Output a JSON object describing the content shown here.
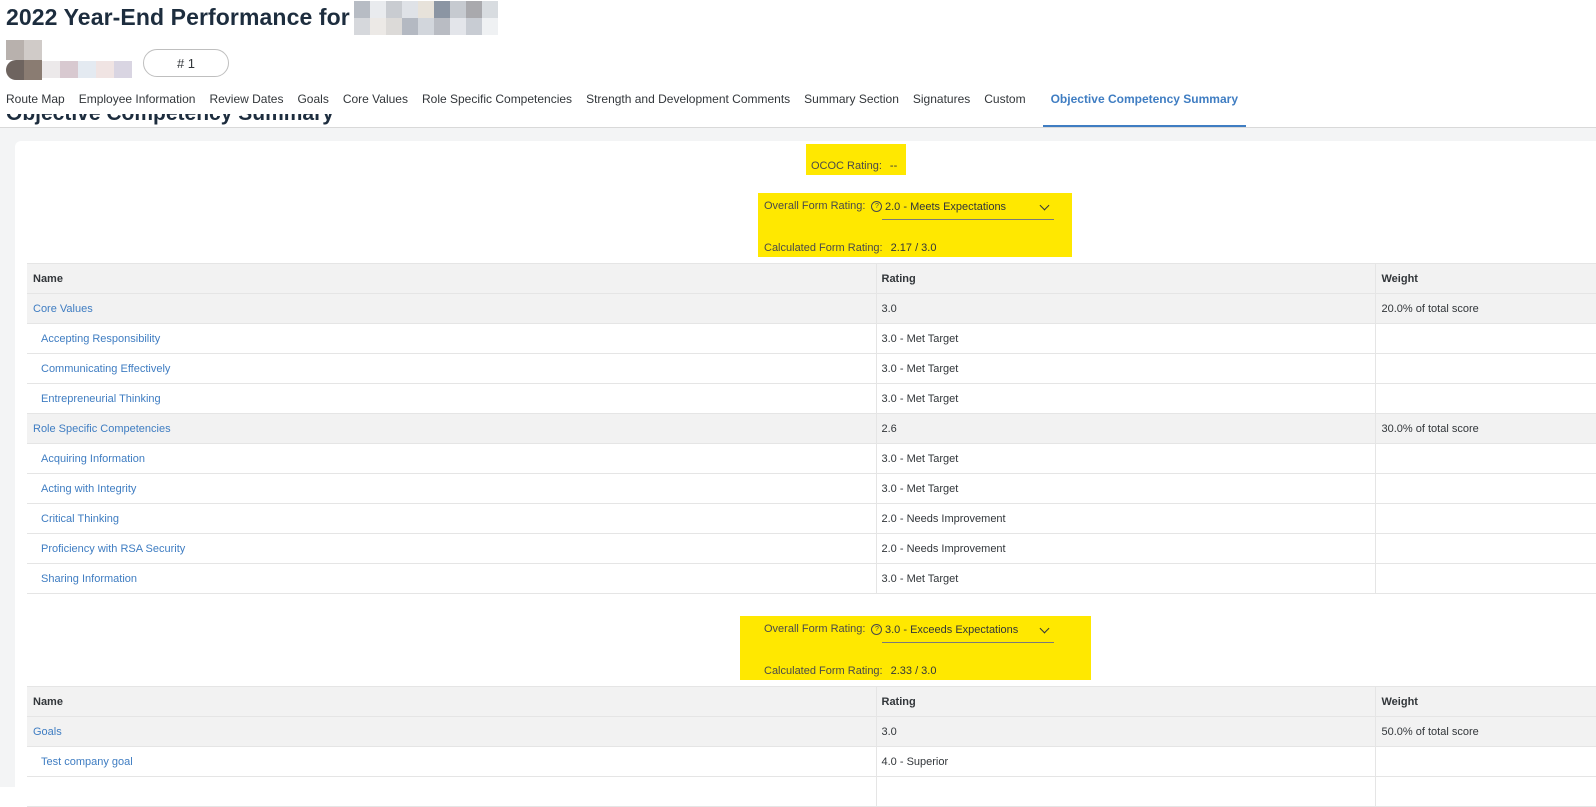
{
  "header": {
    "title": "2022 Year-End Performance for",
    "version_label": "# 1"
  },
  "tabs": [
    {
      "label": "Route Map"
    },
    {
      "label": "Employee Information"
    },
    {
      "label": "Review Dates"
    },
    {
      "label": "Goals"
    },
    {
      "label": "Core Values"
    },
    {
      "label": "Role Specific Competencies"
    },
    {
      "label": "Strength and Development Comments"
    },
    {
      "label": "Summary Section"
    },
    {
      "label": "Signatures"
    },
    {
      "label": "Custom"
    },
    {
      "label": "Objective Competency Summary",
      "active": true
    }
  ],
  "section_title": "Objective Competency Summary",
  "ococ": {
    "label": "OCOC Rating:",
    "value": "--"
  },
  "block1": {
    "overall_label": "Overall Form Rating:",
    "overall_value": "2.0 - Meets Expectations",
    "calc_label": "Calculated Form Rating:",
    "calc_value": "2.17 / 3.0"
  },
  "block2": {
    "overall_label": "Overall Form Rating:",
    "overall_value": "3.0 - Exceeds Expectations",
    "calc_label": "Calculated Form Rating:",
    "calc_value": "2.33 / 3.0"
  },
  "columns": {
    "name": "Name",
    "rating": "Rating",
    "weight": "Weight"
  },
  "table1": [
    {
      "name": "Core Values",
      "rating": "3.0",
      "weight": "20.0% of total score",
      "group": true
    },
    {
      "name": "Accepting Responsibility",
      "rating": "3.0 - Met Target",
      "weight": ""
    },
    {
      "name": "Communicating Effectively",
      "rating": "3.0 - Met Target",
      "weight": ""
    },
    {
      "name": "Entrepreneurial Thinking",
      "rating": "3.0 - Met Target",
      "weight": ""
    },
    {
      "name": "Role Specific Competencies",
      "rating": "2.6",
      "weight": "30.0% of total score",
      "group": true
    },
    {
      "name": "Acquiring Information",
      "rating": "3.0 - Met Target",
      "weight": ""
    },
    {
      "name": "Acting with Integrity",
      "rating": "3.0 - Met Target",
      "weight": ""
    },
    {
      "name": "Critical Thinking",
      "rating": "2.0 - Needs Improvement",
      "weight": ""
    },
    {
      "name": "Proficiency with RSA Security",
      "rating": "2.0 - Needs Improvement",
      "weight": ""
    },
    {
      "name": "Sharing Information",
      "rating": "3.0 - Met Target",
      "weight": ""
    }
  ],
  "table2": [
    {
      "name": "Goals",
      "rating": "3.0",
      "weight": "50.0% of total score",
      "group": true
    },
    {
      "name": "Test company goal",
      "rating": "4.0 - Superior",
      "weight": ""
    },
    {
      "name": "",
      "rating": "",
      "weight": ""
    }
  ],
  "colors": {
    "highlight": "#ffe800",
    "link": "#3f7dc2",
    "title": "#1d2d3e"
  }
}
